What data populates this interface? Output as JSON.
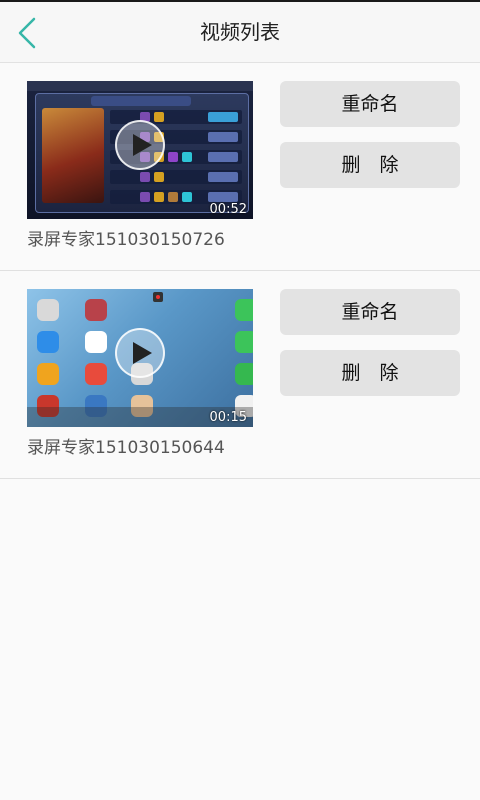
{
  "header": {
    "title": "视频列表"
  },
  "videos": [
    {
      "filename": "录屏专家151030150726",
      "duration": "00:52",
      "rename_label": "重命名",
      "delete_label": "删　除"
    },
    {
      "filename": "录屏专家151030150644",
      "duration": "00:15",
      "rename_label": "重命名",
      "delete_label": "删　除"
    }
  ],
  "colors": {
    "accent": "#36b6a8",
    "button_bg": "#e3e3e3",
    "divider": "#e0e0e0"
  }
}
